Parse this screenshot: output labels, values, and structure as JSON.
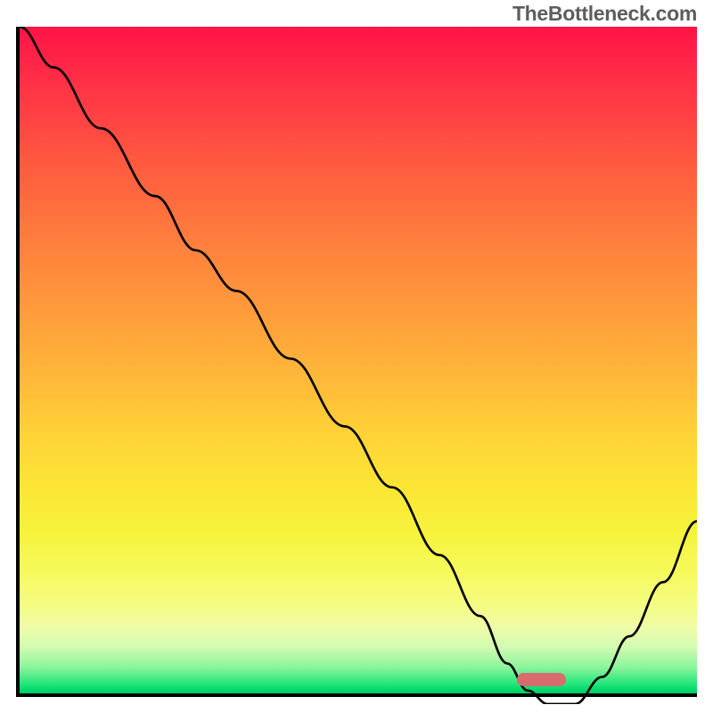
{
  "watermark": "TheBottleneck.com",
  "chart_data": {
    "type": "line",
    "title": "",
    "xlabel": "",
    "ylabel": "",
    "x_range": [
      0,
      100
    ],
    "y_range": [
      0,
      100
    ],
    "series": [
      {
        "name": "curve",
        "x": [
          0,
          5,
          12,
          20,
          26,
          32,
          40,
          48,
          55,
          62,
          68,
          72,
          75,
          78,
          82,
          86,
          90,
          95,
          100
        ],
        "y": [
          100,
          94,
          85,
          75,
          67,
          61,
          51,
          41,
          32,
          22,
          13,
          6,
          2,
          0,
          0,
          4,
          10,
          18,
          27
        ]
      }
    ],
    "marker": {
      "x_center": 77,
      "y": 1.2,
      "color": "#d86b6b"
    },
    "gradient_colors": {
      "top": "#ff1348",
      "mid": "#ffd536",
      "bottom": "#00cc62"
    },
    "notes": "Values are normalized 0–100; axes have no visible tick labels in the source image, so numeric values are estimated from pixel positions relative to the plot box."
  }
}
